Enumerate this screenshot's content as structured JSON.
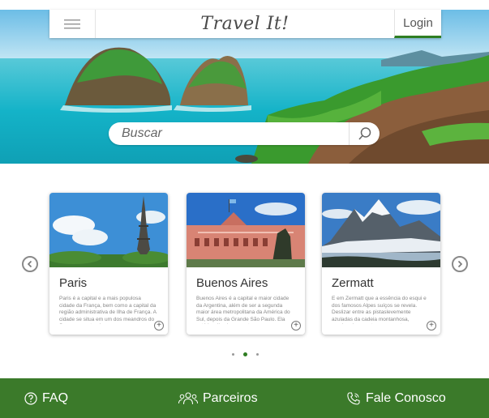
{
  "header": {
    "brand": "Travel It!",
    "login_label": "Login"
  },
  "search": {
    "placeholder": "Buscar"
  },
  "cards": [
    {
      "title": "Paris",
      "text": "Paris é a capital e a mais populosa cidade da França, bem como a capital da região administrativa de Ilha de França. A cidade se situa em um dos meandros do Sena, no centro da ..."
    },
    {
      "title": "Buenos Aires",
      "text": "Buenos Aires é a capital e maior cidade da Argentina, além de ser a segunda maior área metropolitana da América do Sul, depois da Grande São Paulo. Ela está localizada na costa ..."
    },
    {
      "title": "Zermatt",
      "text": "E em Zermatt que a essência do esqui e dos famosos Alpes suíços se revela. Deslizar entre as pistaslevemente azuladas da cadeia montanhosa, respirando o vento puro e corta..."
    }
  ],
  "carousel": {
    "dots": 3,
    "active_dot": 2
  },
  "footer": {
    "faq": "FAQ",
    "partners": "Parceiros",
    "contact": "Fale Conosco"
  },
  "colors": {
    "accent_green": "#3b7a2a",
    "login_underline": "#2f7d22"
  }
}
